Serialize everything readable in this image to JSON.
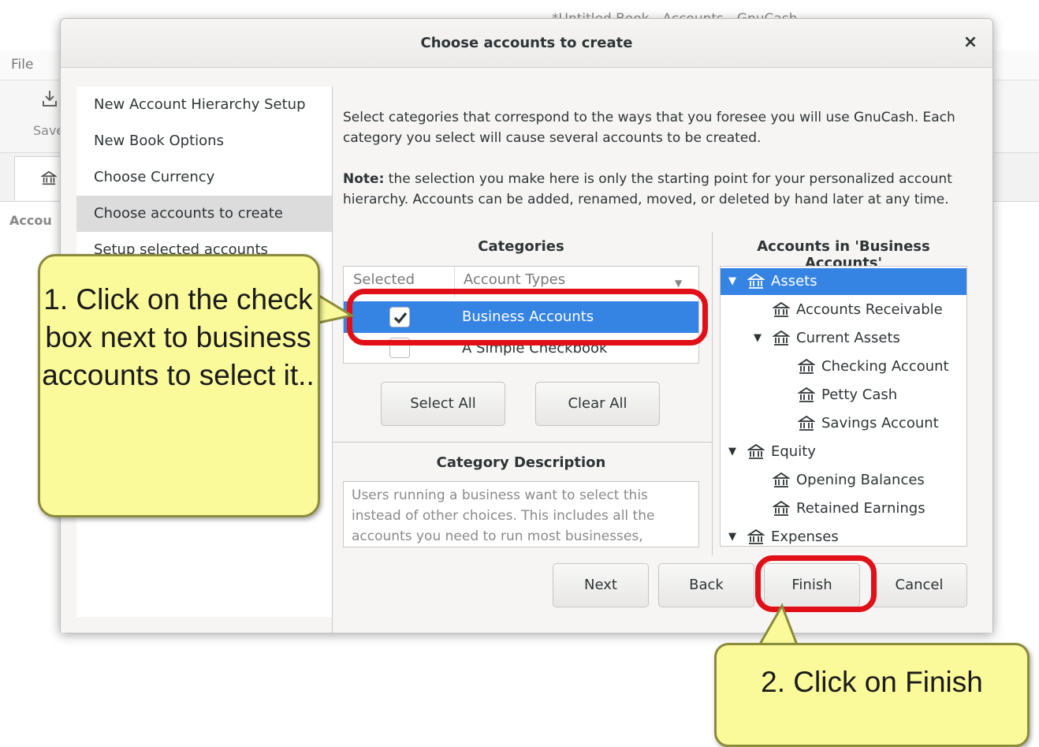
{
  "background_app": {
    "title": "*Untitled Book - Accounts - GnuCash",
    "menu_file": "File",
    "toolbar_save": "Save",
    "tab_accounts": "Accou"
  },
  "dialog": {
    "title": "Choose accounts to create",
    "close_glyph": "×",
    "sidebar": [
      "New Account Hierarchy Setup",
      "New Book Options",
      "Choose Currency",
      "Choose accounts to create",
      "Setup selected accounts"
    ],
    "intro": "Select categories that correspond to the ways that you foresee you will use GnuCash. Each category you select will cause several accounts to be created.",
    "note_bold": "Note:",
    "note_text": " the selection you make here is only the starting point for your personalized account hierarchy. Accounts can be added, renamed, moved, or deleted by hand later at any time.",
    "categories_heading": "Categories",
    "col_selected": "Selected",
    "col_types": "Account Types",
    "categories": [
      {
        "label": "Business Accounts",
        "checked": true
      },
      {
        "label": "A Simple Checkbook",
        "checked": false
      }
    ],
    "select_all": "Select All",
    "clear_all": "Clear All",
    "description_heading": "Category Description",
    "description": "Users running a business want to select this instead of other choices. This includes all the accounts you need to run most businesses,",
    "accounts_heading": "Accounts in 'Business Accounts'",
    "accounts_tree": [
      {
        "label": "Assets",
        "level": 0,
        "expanded": true,
        "selected": true
      },
      {
        "label": "Accounts Receivable",
        "level": 1
      },
      {
        "label": "Current Assets",
        "level": 1,
        "expanded": true
      },
      {
        "label": "Checking Account",
        "level": 2
      },
      {
        "label": "Petty Cash",
        "level": 2
      },
      {
        "label": "Savings Account",
        "level": 2
      },
      {
        "label": "Equity",
        "level": 0,
        "expanded": true
      },
      {
        "label": "Opening Balances",
        "level": 1
      },
      {
        "label": "Retained Earnings",
        "level": 1
      },
      {
        "label": "Expenses",
        "level": 0,
        "expanded": true
      }
    ],
    "buttons": {
      "next": "Next",
      "back": "Back",
      "finish": "Finish",
      "cancel": "Cancel"
    }
  },
  "annotations": {
    "callout1": "1. Click on the check box next to business accounts to select it..",
    "callout2": "2. Click on Finish",
    "highlight_color": "#e10f17",
    "callout_color": "#fafa9a"
  },
  "colors": {
    "selection": "#3584e4"
  }
}
